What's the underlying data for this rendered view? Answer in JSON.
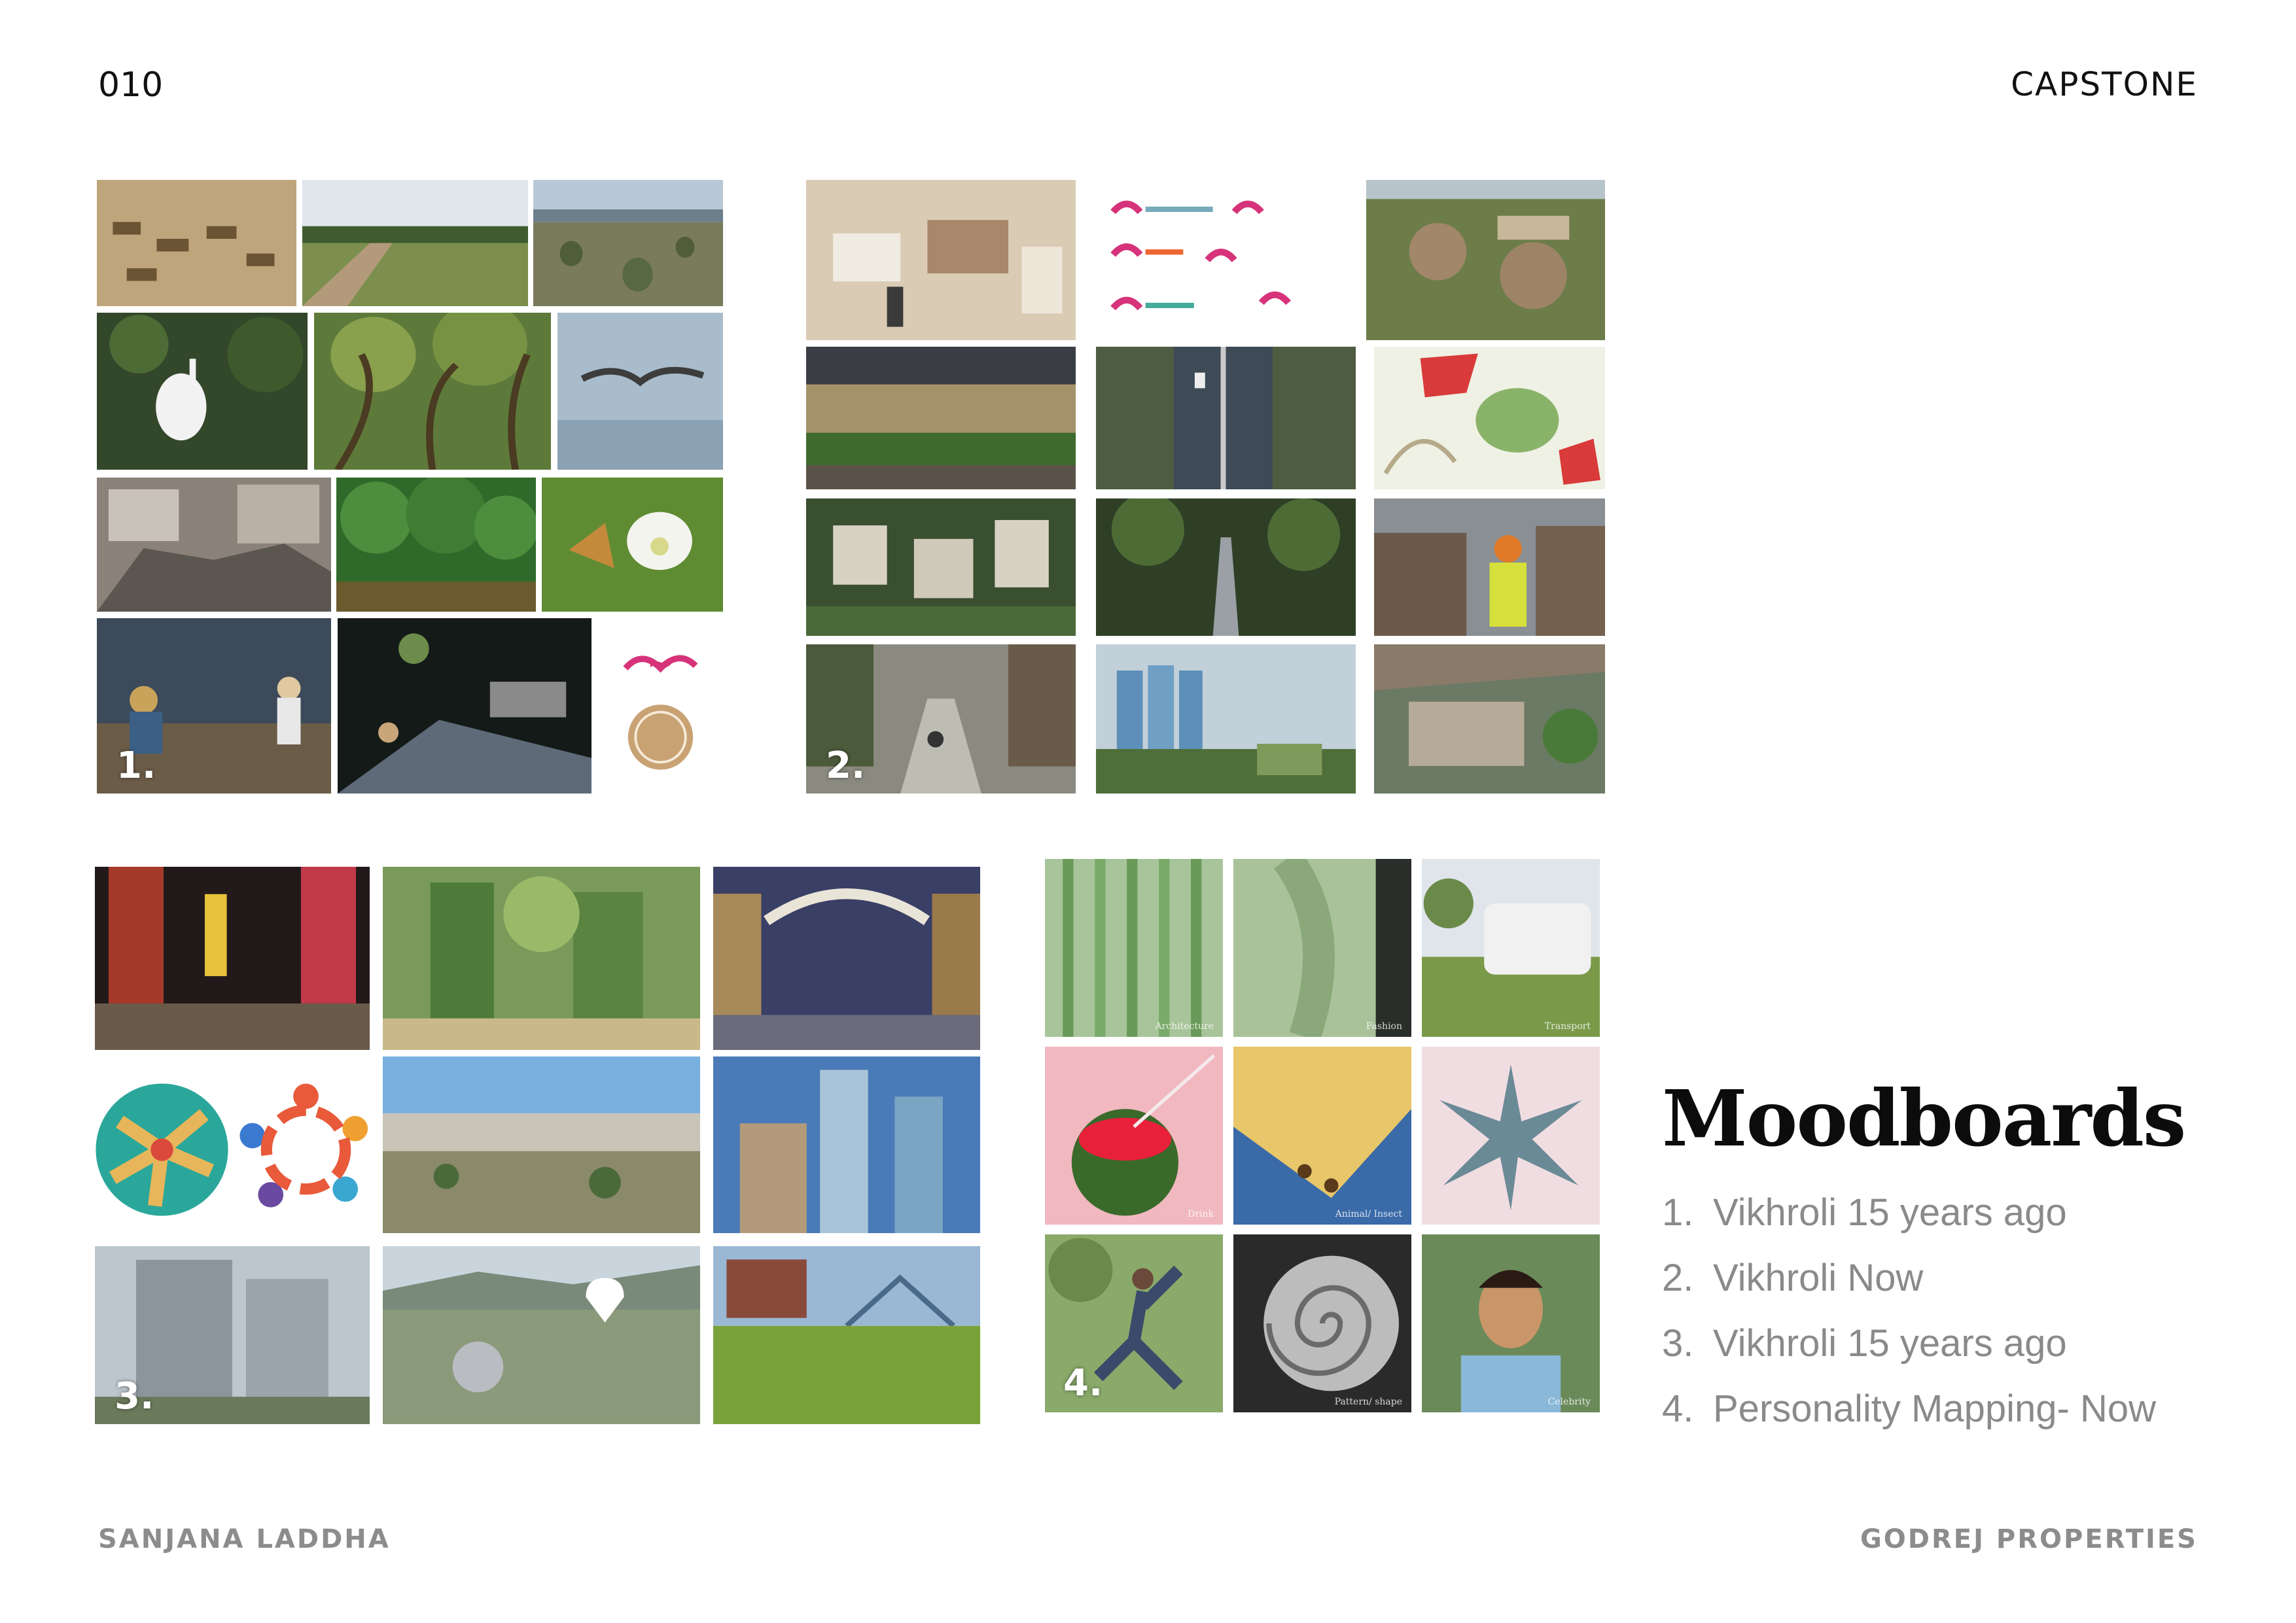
{
  "header": {
    "page_number": "010",
    "title": "CAPSTONE"
  },
  "footer": {
    "author": "SANJANA LADDHA",
    "client": "GODREJ PROPERTIES"
  },
  "section": {
    "title": "Moodboards",
    "items": [
      {
        "num": "1.",
        "label": "Vikhroli 15 years ago"
      },
      {
        "num": "2.",
        "label": "Vikhroli Now"
      },
      {
        "num": "3.",
        "label": "Vikhroli 15 years ago"
      },
      {
        "num": "4.",
        "label": "Personality Mapping- Now"
      }
    ]
  },
  "boards": {
    "b1": {
      "number": "1."
    },
    "b2": {
      "number": "2."
    },
    "b3": {
      "number": "3."
    },
    "b4": {
      "number": "4."
    }
  },
  "colors": {
    "accent": "#0c0c0c",
    "muted": "#8a8a8a"
  }
}
